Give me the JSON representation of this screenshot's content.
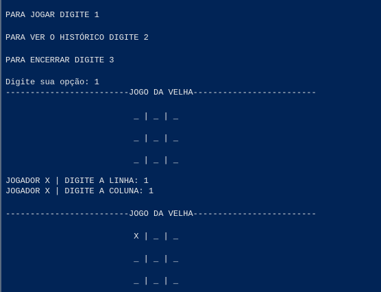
{
  "console": {
    "lines": [
      "PARA JOGAR DIGITE 1",
      "PARA VER O HISTÓRICO DIGITE 2",
      "PARA ENCERRAR DIGITE 3",
      "Digite sua opção: 1",
      "-------------------------JOGO DA VELHA-------------------------",
      "                          _ | _ | _",
      "                          _ | _ | _",
      "                          _ | _ | _",
      "JOGADOR X | DIGITE A LINHA: 1",
      "JOGADOR X | DIGITE A COLUNA: 1",
      "-------------------------JOGO DA VELHA-------------------------",
      "                          X | _ | _",
      "                          _ | _ | _",
      "                          _ | _ | _"
    ]
  }
}
